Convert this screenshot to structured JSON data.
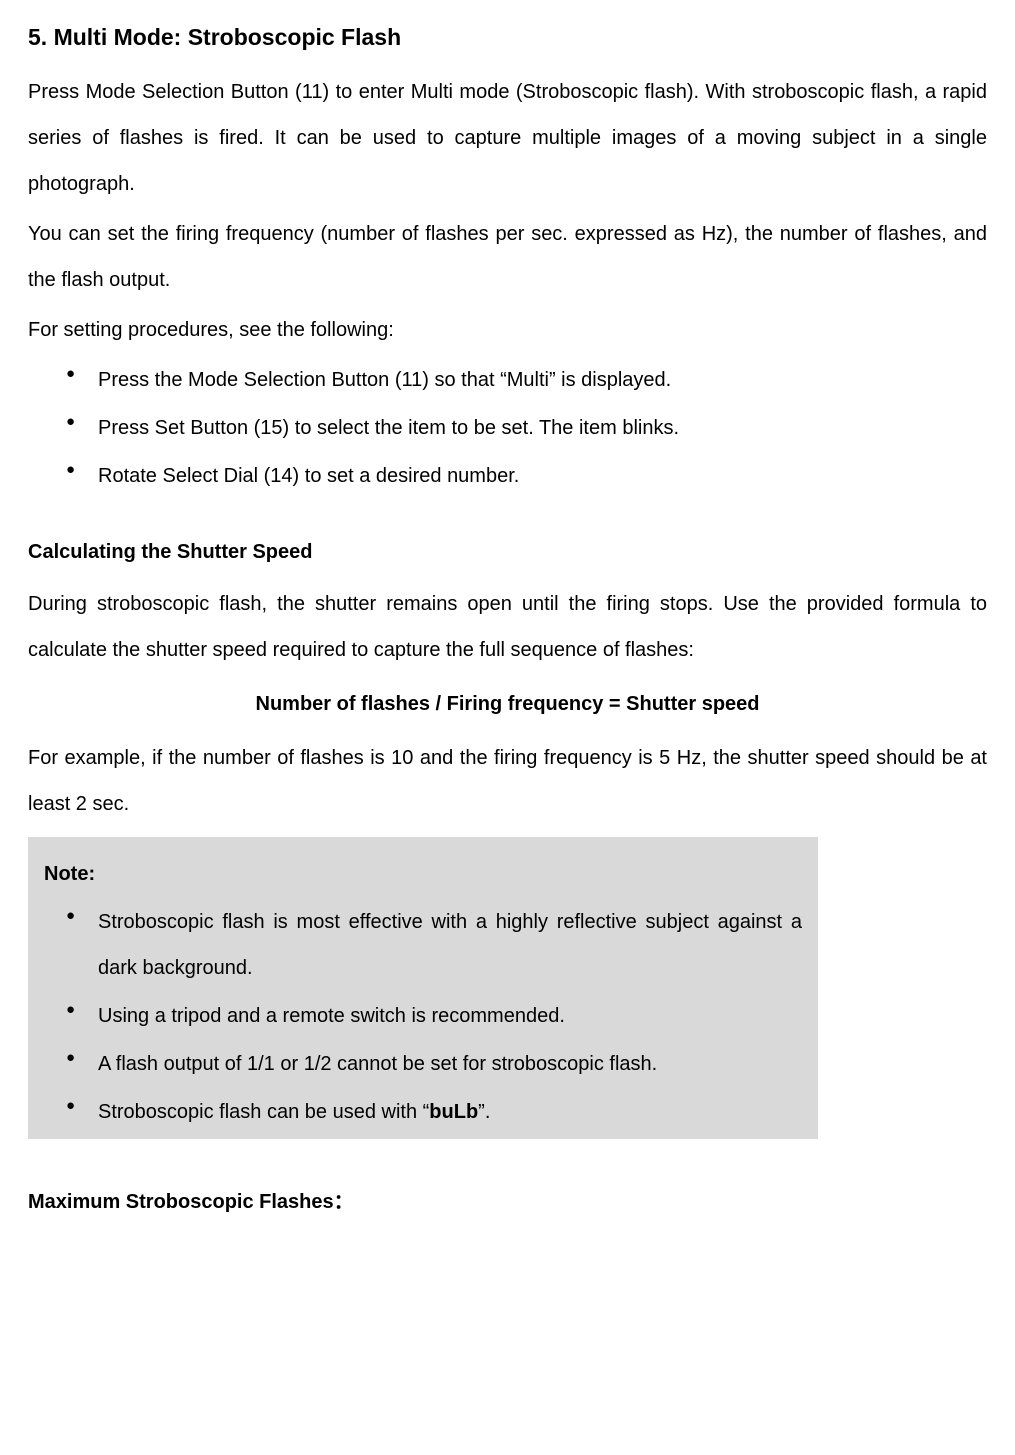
{
  "section_title": "5. Multi Mode: Stroboscopic Flash",
  "intro_para_1": "Press Mode Selection Button (11) to enter Multi mode (Stroboscopic flash). With stroboscopic flash, a rapid series of flashes is fired. It can be used to capture multiple images of a moving subject in a single photograph.",
  "intro_para_2": "You can set the firing frequency (number of flashes per sec. expressed as Hz), the number of flashes, and the flash output.",
  "intro_para_3": "For setting procedures, see the following:",
  "bullets": {
    "0": "Press the Mode Selection Button (11) so that “Multi” is displayed.",
    "1": "Press Set Button (15) to select the item to be set. The item blinks.",
    "2": "Rotate Select Dial (14) to set a desired number."
  },
  "calc_heading": "Calculating the Shutter Speed",
  "calc_body_1": "During stroboscopic flash, the shutter remains open until the firing stops. Use the provided formula to calculate the shutter speed required to capture the full sequence of flashes:",
  "formula": "Number of flashes / Firing frequency = Shutter speed",
  "calc_body_2": "For example, if the number of flashes is 10 and the firing frequency is 5 Hz, the shutter speed should be at least 2 sec.",
  "note_title": "Note:",
  "notes": {
    "0": "Stroboscopic flash is most effective with a highly reflective subject against a dark background.",
    "1": "Using a tripod and a remote switch is recommended.",
    "2": "A flash output of 1/1 or 1/2 cannot be set for stroboscopic flash.",
    "3_prefix": "Stroboscopic flash can be used with “",
    "3_bold": "buLb",
    "3_suffix": "”."
  },
  "bottom_heading": "Maximum Stroboscopic Flashes："
}
